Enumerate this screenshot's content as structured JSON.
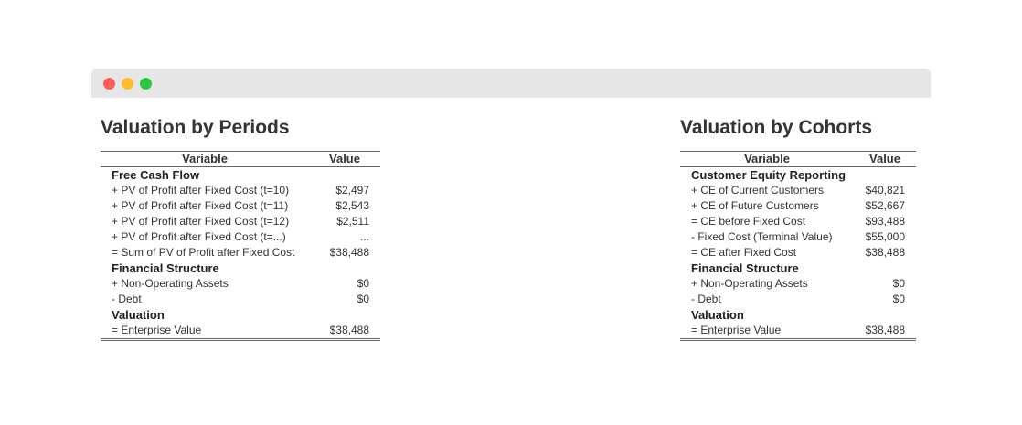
{
  "window": {
    "dots": {
      "red": "#ff5f57",
      "yellow": "#febc2e",
      "green": "#28c840"
    },
    "bar_color": "#e6e6e6"
  },
  "periods": {
    "title": "Valuation by Periods",
    "col_variable": "Variable",
    "col_value": "Value",
    "rows": [
      {
        "group": true,
        "label": "Free Cash Flow",
        "value": ""
      },
      {
        "label": "+ PV of Profit after Fixed Cost (t=10)",
        "value": "$2,497"
      },
      {
        "label": "+ PV of Profit after Fixed Cost (t=11)",
        "value": "$2,543"
      },
      {
        "label": "+ PV of Profit after Fixed Cost (t=12)",
        "value": "$2,511"
      },
      {
        "label": "+ PV of Profit after Fixed Cost (t=...)",
        "value": "..."
      },
      {
        "label": "= Sum of PV of Profit after Fixed Cost",
        "value": "$38,488"
      },
      {
        "group": true,
        "label": "Financial Structure",
        "value": ""
      },
      {
        "label": "+ Non-Operating Assets",
        "value": "$0"
      },
      {
        "label": "- Debt",
        "value": "$0"
      },
      {
        "group": true,
        "label": "Valuation",
        "value": ""
      },
      {
        "label": "= Enterprise Value",
        "value": "$38,488"
      }
    ]
  },
  "cohorts": {
    "title": "Valuation by Cohorts",
    "col_variable": "Variable",
    "col_value": "Value",
    "rows": [
      {
        "group": true,
        "label": "Customer Equity Reporting",
        "value": ""
      },
      {
        "label": "+ CE of Current Customers",
        "value": "$40,821"
      },
      {
        "label": "+ CE of Future Customers",
        "value": "$52,667"
      },
      {
        "label": "= CE before Fixed Cost",
        "value": "$93,488"
      },
      {
        "label": "- Fixed Cost (Terminal Value)",
        "value": "$55,000"
      },
      {
        "label": "= CE after Fixed Cost",
        "value": "$38,488"
      },
      {
        "group": true,
        "label": "Financial Structure",
        "value": ""
      },
      {
        "label": "+ Non-Operating Assets",
        "value": "$0"
      },
      {
        "label": "- Debt",
        "value": "$0"
      },
      {
        "group": true,
        "label": "Valuation",
        "value": ""
      },
      {
        "label": "= Enterprise Value",
        "value": "$38,488"
      }
    ]
  }
}
